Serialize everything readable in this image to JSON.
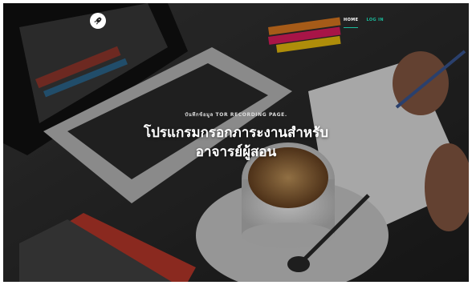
{
  "brand": {
    "logo_icon": "rocket-icon"
  },
  "nav": {
    "items": [
      {
        "label": "HOME",
        "active": true
      },
      {
        "label": "LOG IN",
        "active": false
      }
    ],
    "accent_color": "#1abc9c"
  },
  "hero": {
    "subheading": "บันทึกข้อมูล TOR RECORDING PAGE.",
    "heading_line1": "โปรแกรมกรอกภาระงานสำหรับ",
    "heading_line2": "อาจารย์ผู้สอน",
    "background": "desk photo: laptop, coffee cup, notebook, pens"
  }
}
